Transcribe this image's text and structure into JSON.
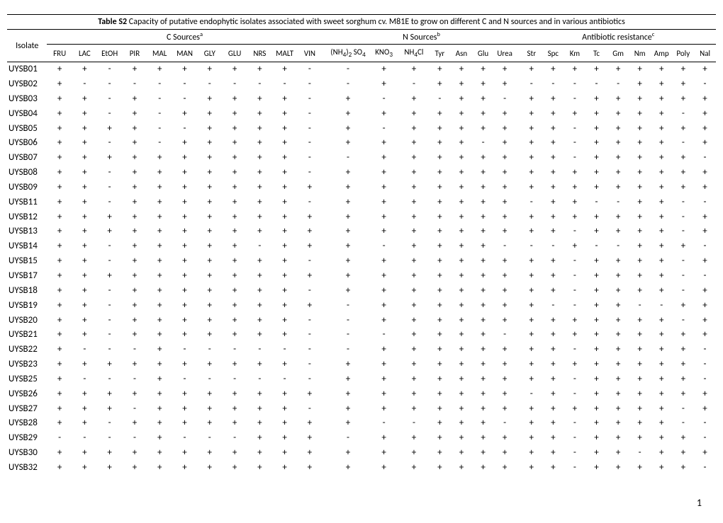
{
  "title_bold": "Table S2",
  "title_rest": " Capacity of putative endophytic isolates associated with sweet sorghum cv. M81E to grow on different C and N sources and in various antibiotics",
  "isolate_label": "Isolate",
  "group_c": "C Sources",
  "group_c_sup": "a",
  "group_n": "N Sources",
  "group_n_sup": "b",
  "group_ab": "Antibiotic resistance",
  "group_ab_sup": "c",
  "c_cols": [
    "FRU",
    "LAC",
    "EtOH",
    "PIR",
    "MAL",
    "MAN",
    "GLY",
    "GLU",
    "NRS",
    "MALT",
    "VIN"
  ],
  "n_cols_pre": "(NH",
  "n_cols_sub1": "4",
  "n_cols_mid": ")",
  "n_cols_sub2": "2",
  "n_cols_end": " SO",
  "n_cols_sub3": "4",
  "n_col2_pre": "KNO",
  "n_col2_sub": "3",
  "n_col3_pre": "NH",
  "n_col3_sub": "4",
  "n_col3_end": "Cl",
  "n_cols_rest": [
    "Tyr",
    "Asn",
    "Glu",
    "Urea"
  ],
  "ab_cols": [
    "Str",
    "Spc",
    "Km",
    "Tc",
    "Gm",
    "Nm",
    "Amp",
    "Poly",
    "Nal"
  ],
  "rows": [
    {
      "id": "UYSB01",
      "c": [
        "+",
        "+",
        "-",
        "+",
        "+",
        "+",
        "+",
        "+",
        "+",
        "+",
        "-"
      ],
      "n": [
        "-",
        "+",
        "+",
        "+",
        "+",
        "+",
        "+"
      ],
      "a": [
        "+",
        "+",
        "+",
        "+",
        "+",
        "+",
        "+",
        "+",
        "+"
      ]
    },
    {
      "id": "UYSB02",
      "c": [
        "+",
        "-",
        "-",
        "-",
        "-",
        "-",
        "-",
        "-",
        "-",
        "-",
        "-"
      ],
      "n": [
        "-",
        "+",
        "-",
        "+",
        "+",
        "+",
        "+"
      ],
      "a": [
        "-",
        "-",
        "-",
        "-",
        "-",
        "+",
        "+",
        "+",
        "-"
      ]
    },
    {
      "id": "UYSB03",
      "c": [
        "+",
        "+",
        "-",
        "+",
        "-",
        "-",
        "+",
        "+",
        "+",
        "+",
        "-"
      ],
      "n": [
        "+",
        "-",
        "+",
        "-",
        "+",
        "+",
        "-"
      ],
      "a": [
        "+",
        "+",
        "-",
        "+",
        "+",
        "+",
        "+",
        "+",
        "+"
      ]
    },
    {
      "id": "UYSB04",
      "c": [
        "+",
        "+",
        "-",
        "+",
        "-",
        "+",
        "+",
        "+",
        "+",
        "+",
        "-"
      ],
      "n": [
        "+",
        "+",
        "+",
        "+",
        "+",
        "+",
        "+"
      ],
      "a": [
        "+",
        "+",
        "+",
        "+",
        "+",
        "+",
        "+",
        "-",
        "+"
      ]
    },
    {
      "id": "UYSB05",
      "c": [
        "+",
        "+",
        "+",
        "+",
        "-",
        "-",
        "+",
        "+",
        "+",
        "+",
        "-"
      ],
      "n": [
        "+",
        "-",
        "+",
        "+",
        "+",
        "+",
        "+"
      ],
      "a": [
        "+",
        "+",
        "-",
        "+",
        "+",
        "+",
        "+",
        "+",
        "+"
      ]
    },
    {
      "id": "UYSB06",
      "c": [
        "+",
        "+",
        "-",
        "+",
        "-",
        "+",
        "+",
        "+",
        "+",
        "+",
        "-"
      ],
      "n": [
        "+",
        "+",
        "+",
        "+",
        "+",
        "-",
        "+"
      ],
      "a": [
        "+",
        "+",
        "-",
        "+",
        "+",
        "+",
        "+",
        "-",
        "+"
      ]
    },
    {
      "id": "UYSB07",
      "c": [
        "+",
        "+",
        "+",
        "+",
        "+",
        "+",
        "+",
        "+",
        "+",
        "+",
        "-"
      ],
      "n": [
        "-",
        "+",
        "+",
        "+",
        "+",
        "+",
        "+"
      ],
      "a": [
        "+",
        "+",
        "-",
        "+",
        "+",
        "+",
        "+",
        "+",
        "-"
      ]
    },
    {
      "id": "UYSB08",
      "c": [
        "+",
        "+",
        "-",
        "+",
        "+",
        "+",
        "+",
        "+",
        "+",
        "+",
        "-"
      ],
      "n": [
        "+",
        "+",
        "+",
        "+",
        "+",
        "+",
        "+"
      ],
      "a": [
        "+",
        "+",
        "+",
        "+",
        "+",
        "+",
        "+",
        "+",
        "+"
      ]
    },
    {
      "id": "UYSB09",
      "c": [
        "+",
        "+",
        "-",
        "+",
        "+",
        "+",
        "+",
        "+",
        "+",
        "+",
        "+"
      ],
      "n": [
        "+",
        "+",
        "+",
        "+",
        "+",
        "+",
        "+"
      ],
      "a": [
        "+",
        "+",
        "+",
        "+",
        "+",
        "+",
        "+",
        "+",
        "+"
      ]
    },
    {
      "id": "UYSB11",
      "c": [
        "+",
        "+",
        "-",
        "+",
        "+",
        "+",
        "+",
        "+",
        "+",
        "+",
        "-"
      ],
      "n": [
        "+",
        "+",
        "+",
        "+",
        "+",
        "+",
        "+"
      ],
      "a": [
        "-",
        "+",
        "+",
        "-",
        "-",
        "+",
        "+",
        "-",
        "-"
      ]
    },
    {
      "id": "UYSB12",
      "c": [
        "+",
        "+",
        "+",
        "+",
        "+",
        "+",
        "+",
        "+",
        "+",
        "+",
        "+"
      ],
      "n": [
        "+",
        "+",
        "+",
        "+",
        "+",
        "+",
        "+"
      ],
      "a": [
        "+",
        "+",
        "+",
        "+",
        "+",
        "+",
        "+",
        "-",
        "+"
      ]
    },
    {
      "id": "UYSB13",
      "c": [
        "+",
        "+",
        "+",
        "+",
        "+",
        "+",
        "+",
        "+",
        "+",
        "+",
        "+"
      ],
      "n": [
        "+",
        "+",
        "+",
        "+",
        "+",
        "+",
        "+"
      ],
      "a": [
        "+",
        "+",
        "-",
        "+",
        "+",
        "+",
        "+",
        "-",
        "+"
      ]
    },
    {
      "id": "UYSB14",
      "c": [
        "+",
        "+",
        "-",
        "+",
        "+",
        "+",
        "+",
        "+",
        "-",
        "+",
        "+"
      ],
      "n": [
        "+",
        "-",
        "+",
        "+",
        "+",
        "+",
        "-"
      ],
      "a": [
        "-",
        "-",
        "+",
        "-",
        "-",
        "+",
        "+",
        "+",
        "-"
      ]
    },
    {
      "id": "UYSB15",
      "c": [
        "+",
        "+",
        "-",
        "+",
        "+",
        "+",
        "+",
        "+",
        "+",
        "+",
        "-"
      ],
      "n": [
        "+",
        "+",
        "+",
        "+",
        "+",
        "+",
        "+"
      ],
      "a": [
        "+",
        "+",
        "-",
        "+",
        "+",
        "+",
        "+",
        "-",
        "+"
      ]
    },
    {
      "id": "UYSB17",
      "c": [
        "+",
        "+",
        "+",
        "+",
        "+",
        "+",
        "+",
        "+",
        "+",
        "+",
        "+"
      ],
      "n": [
        "+",
        "+",
        "+",
        "+",
        "+",
        "+",
        "+"
      ],
      "a": [
        "+",
        "+",
        "-",
        "+",
        "+",
        "+",
        "+",
        "-",
        "-"
      ]
    },
    {
      "id": "UYSB18",
      "c": [
        "+",
        "+",
        "-",
        "+",
        "+",
        "+",
        "+",
        "+",
        "+",
        "+",
        "-"
      ],
      "n": [
        "+",
        "+",
        "+",
        "+",
        "+",
        "+",
        "+"
      ],
      "a": [
        "+",
        "+",
        "-",
        "+",
        "+",
        "+",
        "+",
        "-",
        "+"
      ]
    },
    {
      "id": "UYSB19",
      "c": [
        "+",
        "+",
        "-",
        "+",
        "+",
        "+",
        "+",
        "+",
        "+",
        "+",
        "+"
      ],
      "n": [
        "-",
        "+",
        "+",
        "+",
        "+",
        "+",
        "+"
      ],
      "a": [
        "+",
        "-",
        "-",
        "+",
        "+",
        "-",
        "-",
        "+",
        "+"
      ]
    },
    {
      "id": "UYSB20",
      "c": [
        "+",
        "+",
        "-",
        "+",
        "+",
        "+",
        "+",
        "+",
        "+",
        "+",
        "-"
      ],
      "n": [
        "-",
        "+",
        "+",
        "+",
        "+",
        "+",
        "+"
      ],
      "a": [
        "+",
        "+",
        "+",
        "+",
        "+",
        "+",
        "+",
        "-",
        "+"
      ]
    },
    {
      "id": "UYSB21",
      "c": [
        "+",
        "+",
        "-",
        "+",
        "+",
        "+",
        "+",
        "+",
        "+",
        "+",
        "-"
      ],
      "n": [
        "-",
        "-",
        "+",
        "+",
        "+",
        "+",
        "-"
      ],
      "a": [
        "+",
        "+",
        "+",
        "+",
        "+",
        "+",
        "+",
        "+",
        "+"
      ]
    },
    {
      "id": "UYSB22",
      "c": [
        "+",
        "-",
        "-",
        "-",
        "+",
        "-",
        "-",
        "-",
        "-",
        "-",
        "-"
      ],
      "n": [
        "-",
        "+",
        "+",
        "+",
        "+",
        "+",
        "+"
      ],
      "a": [
        "+",
        "+",
        "-",
        "+",
        "+",
        "+",
        "+",
        "+",
        "-"
      ]
    },
    {
      "id": "UYSB23",
      "c": [
        "+",
        "+",
        "+",
        "+",
        "+",
        "+",
        "+",
        "+",
        "+",
        "+",
        "-"
      ],
      "n": [
        "+",
        "+",
        "+",
        "+",
        "+",
        "+",
        "+"
      ],
      "a": [
        "+",
        "+",
        "+",
        "+",
        "+",
        "+",
        "+",
        "+",
        "-"
      ]
    },
    {
      "id": "UYSB25",
      "c": [
        "+",
        "-",
        "-",
        "-",
        "+",
        "-",
        "-",
        "-",
        "-",
        "-",
        "-"
      ],
      "n": [
        "+",
        "+",
        "+",
        "+",
        "+",
        "+",
        "+"
      ],
      "a": [
        "+",
        "+",
        "-",
        "+",
        "+",
        "+",
        "+",
        "+",
        "-"
      ]
    },
    {
      "id": "UYSB26",
      "c": [
        "+",
        "+",
        "+",
        "+",
        "+",
        "+",
        "+",
        "+",
        "+",
        "+",
        "+"
      ],
      "n": [
        "+",
        "+",
        "+",
        "+",
        "+",
        "+",
        "+"
      ],
      "a": [
        "-",
        "+",
        "-",
        "+",
        "+",
        "+",
        "+",
        "+",
        "+"
      ]
    },
    {
      "id": "UYSB27",
      "c": [
        "+",
        "+",
        "+",
        "-",
        "+",
        "+",
        "+",
        "+",
        "+",
        "+",
        "-"
      ],
      "n": [
        "+",
        "+",
        "+",
        "+",
        "+",
        "+",
        "+"
      ],
      "a": [
        "+",
        "+",
        "+",
        "+",
        "+",
        "+",
        "+",
        "-",
        "+"
      ]
    },
    {
      "id": "UYSB28",
      "c": [
        "+",
        "+",
        "-",
        "+",
        "+",
        "+",
        "+",
        "+",
        "+",
        "+",
        "+"
      ],
      "n": [
        "+",
        "-",
        "-",
        "+",
        "+",
        "+",
        "-"
      ],
      "a": [
        "+",
        "+",
        "-",
        "+",
        "+",
        "+",
        "+",
        "-",
        "-"
      ]
    },
    {
      "id": "UYSB29",
      "c": [
        "-",
        "-",
        "-",
        "-",
        "+",
        "-",
        "-",
        "-",
        "+",
        "+",
        "+"
      ],
      "n": [
        "-",
        "+",
        "+",
        "+",
        "+",
        "+",
        "+"
      ],
      "a": [
        "+",
        "+",
        "-",
        "+",
        "+",
        "+",
        "+",
        "+",
        "-"
      ]
    },
    {
      "id": "UYSB30",
      "c": [
        "+",
        "+",
        "+",
        "+",
        "+",
        "+",
        "+",
        "+",
        "+",
        "+",
        "+"
      ],
      "n": [
        "+",
        "+",
        "+",
        "+",
        "+",
        "+",
        "+"
      ],
      "a": [
        "+",
        "+",
        "-",
        "+",
        "+",
        "-",
        "+",
        "+",
        "+"
      ]
    },
    {
      "id": "UYSB32",
      "c": [
        "+",
        "+",
        "+",
        "+",
        "+",
        "+",
        "+",
        "+",
        "+",
        "+",
        "+"
      ],
      "n": [
        "+",
        "+",
        "+",
        "+",
        "+",
        "+",
        "+"
      ],
      "a": [
        "+",
        "+",
        "-",
        "+",
        "+",
        "+",
        "+",
        "+",
        "-"
      ]
    }
  ],
  "page_number": "1"
}
